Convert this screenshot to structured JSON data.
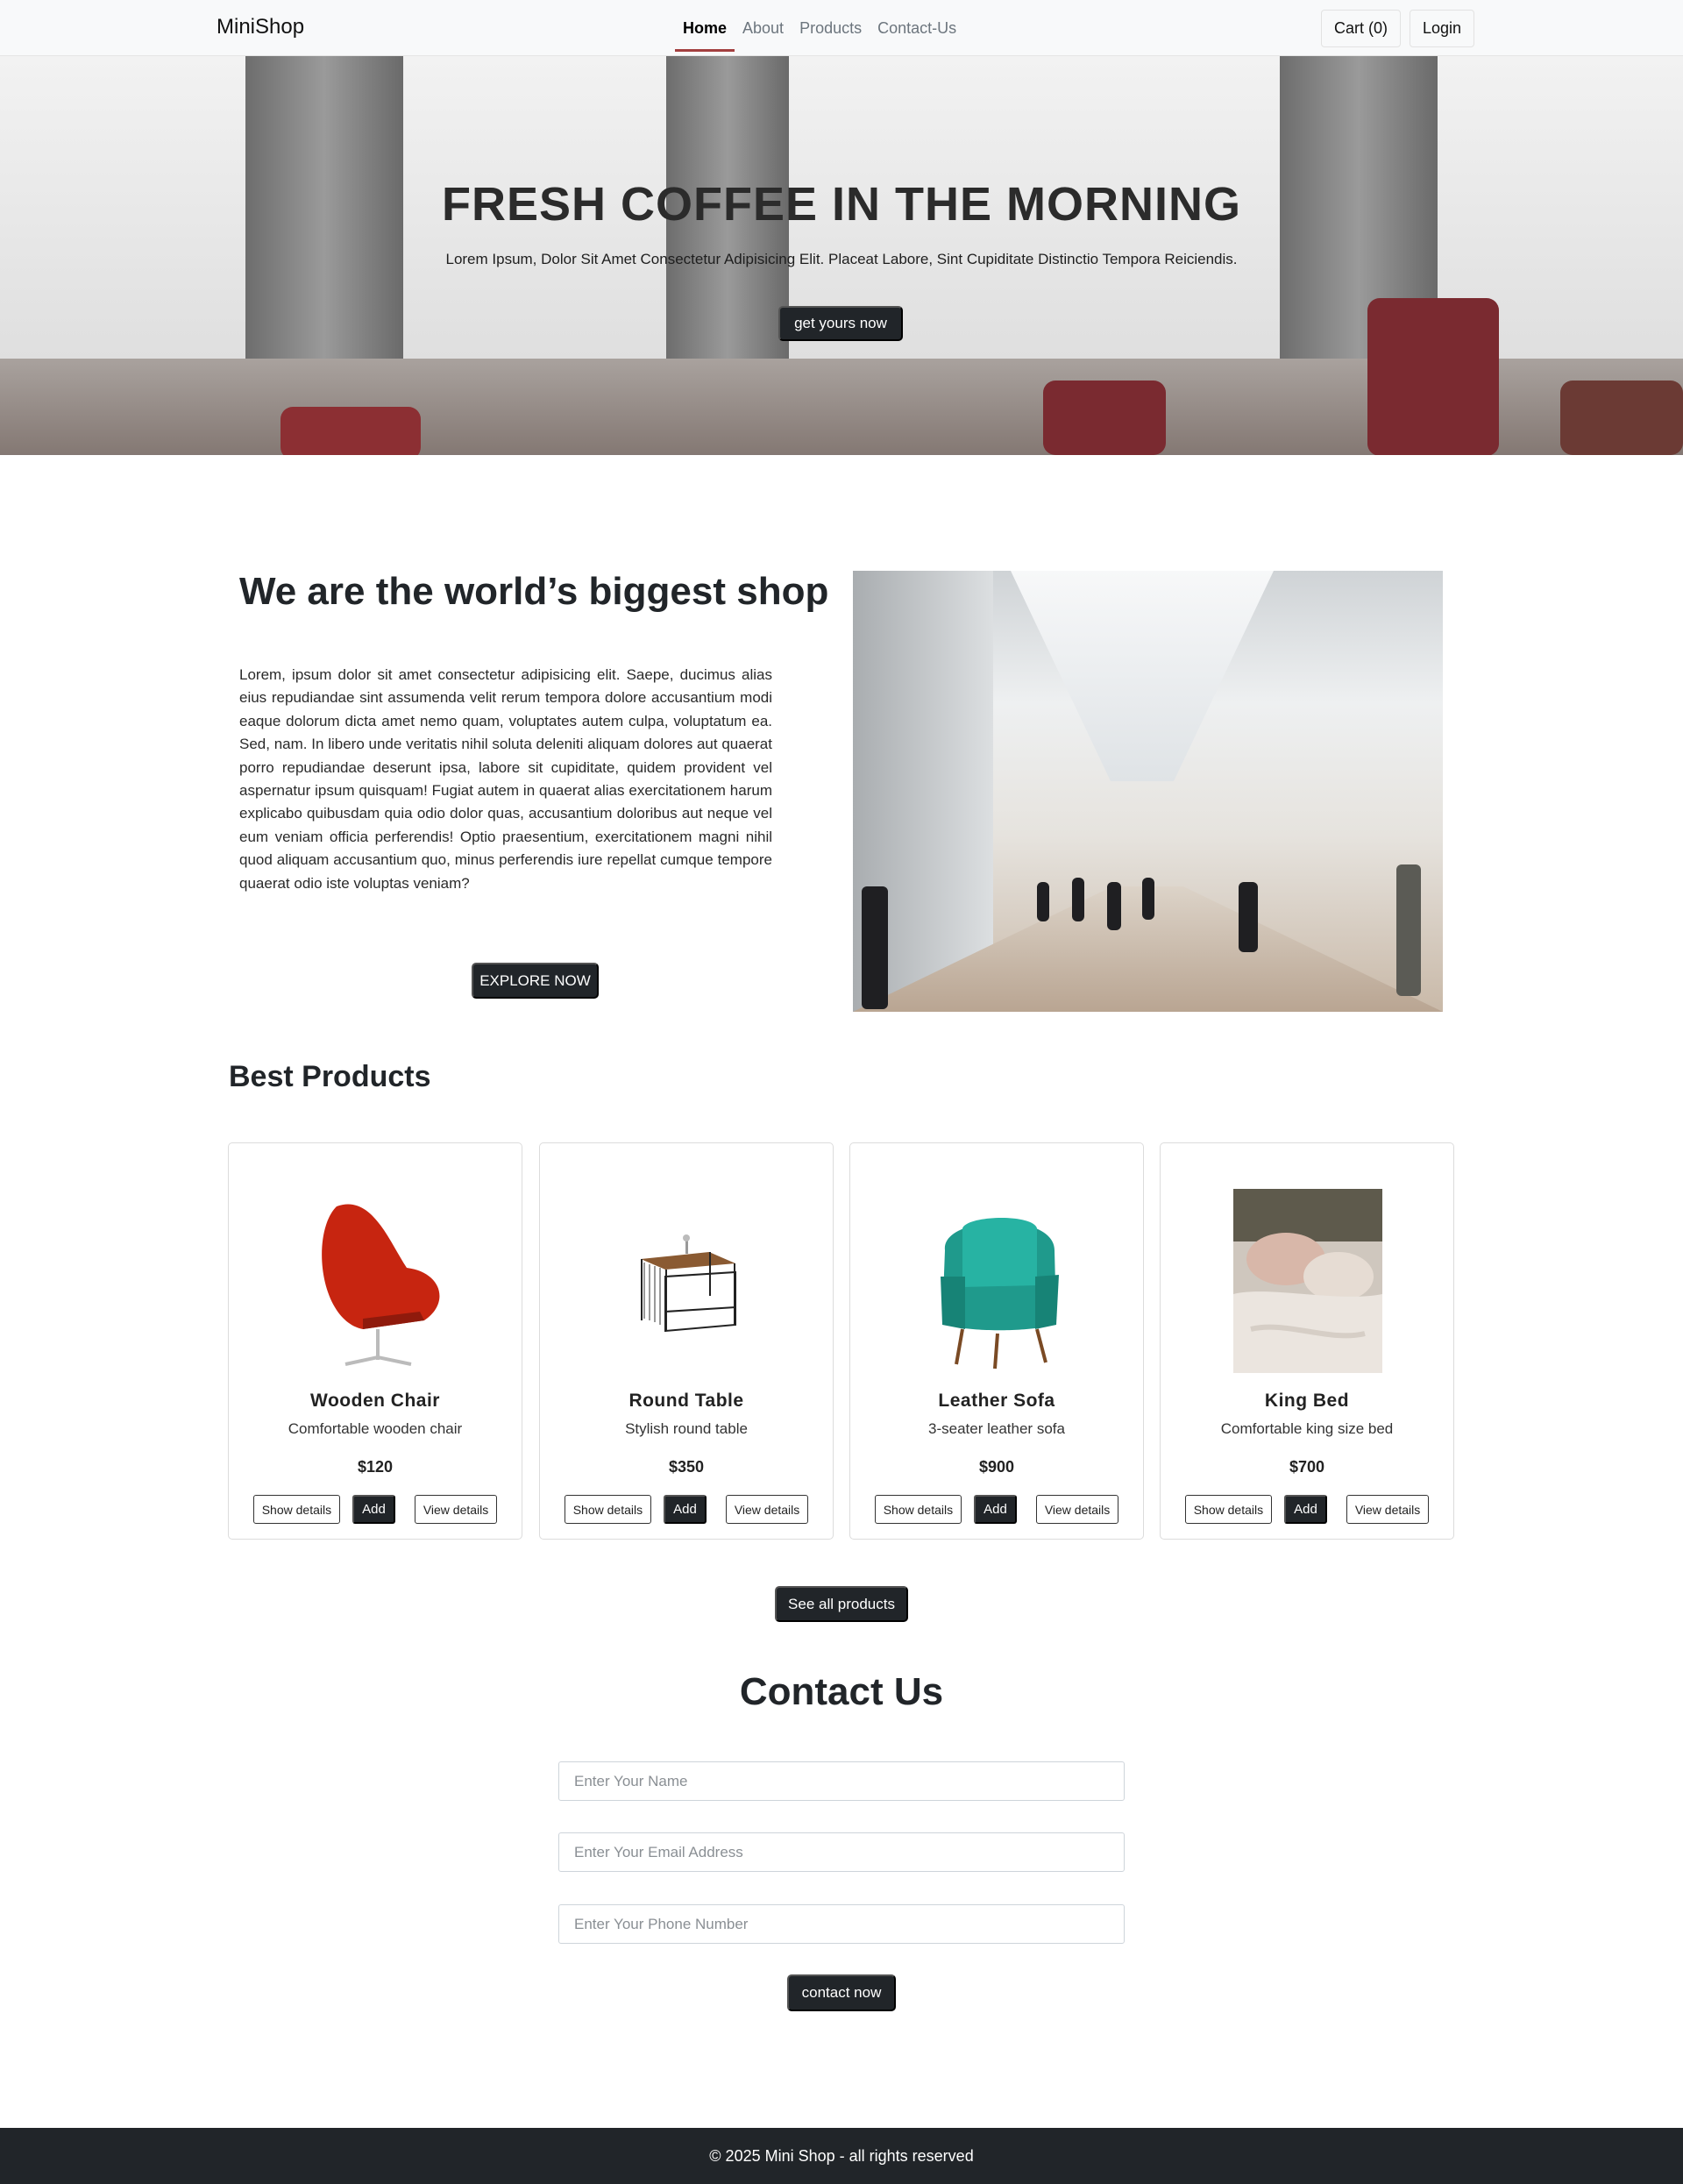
{
  "navbar": {
    "brand": "MiniShop",
    "links": [
      "Home",
      "About",
      "Products",
      "Contact-Us"
    ],
    "active_link": "Home",
    "cart_label": "Cart (0)",
    "login_label": "Login"
  },
  "hero": {
    "title": "FRESH COFFEE IN THE MORNING",
    "subtitle": "Lorem Ipsum, Dolor Sit Amet Consectetur Adipisicing Elit. Placeat Labore, Sint Cupiditate Distinctio Tempora Reiciendis.",
    "button_label": "get yours now"
  },
  "about": {
    "title": "We are the world’s biggest shop",
    "text": "Lorem, ipsum dolor sit amet consectetur adipisicing elit. Saepe, ducimus alias eius repudiandae sint assumenda velit rerum tempora dolore accusantium modi eaque dolorum dicta amet nemo quam, voluptates autem culpa, voluptatum ea. Sed, nam. In libero unde veritatis nihil soluta deleniti aliquam dolores aut quaerat porro repudiandae deserunt ipsa, labore sit cupiditate, quidem provident vel aspernatur ipsum quisquam! Fugiat autem in quaerat alias exercitationem harum explicabo quibusdam quia odio dolor quas, accusantium doloribus aut neque vel eum veniam officia perferendis! Optio praesentium, exercitationem magni nihil quod aliquam accusantium quo, minus perferendis iure repellat cumque tempore quaerat odio iste voluptas veniam?",
    "button_label": "EXPLORE NOW"
  },
  "products": {
    "title": "Best Products",
    "items": [
      {
        "name": "Wooden Chair",
        "description": "Comfortable wooden chair",
        "price": "$120",
        "show_label": "Show details",
        "add_label": "Add",
        "view_label": "View details"
      },
      {
        "name": "Round Table",
        "description": "Stylish round table",
        "price": "$350",
        "show_label": "Show details",
        "add_label": "Add",
        "view_label": "View details"
      },
      {
        "name": "Leather Sofa",
        "description": "3-seater leather sofa",
        "price": "$900",
        "show_label": "Show details",
        "add_label": "Add",
        "view_label": "View details"
      },
      {
        "name": "King Bed",
        "description": "Comfortable king size bed",
        "price": "$700",
        "show_label": "Show details",
        "add_label": "Add",
        "view_label": "View details"
      }
    ],
    "see_all_label": "See all products"
  },
  "contact": {
    "title": "Contact Us",
    "name_placeholder": "Enter Your Name",
    "email_placeholder": "Enter Your Email Address",
    "phone_placeholder": "Enter Your Phone Number",
    "button_label": "contact now"
  },
  "footer": {
    "text": "© 2025 Mini Shop - all rights reserved"
  },
  "colors": {
    "dark": "#212529",
    "navbar_bg": "#f8f9fa",
    "active_underline": "#a33f3f"
  }
}
